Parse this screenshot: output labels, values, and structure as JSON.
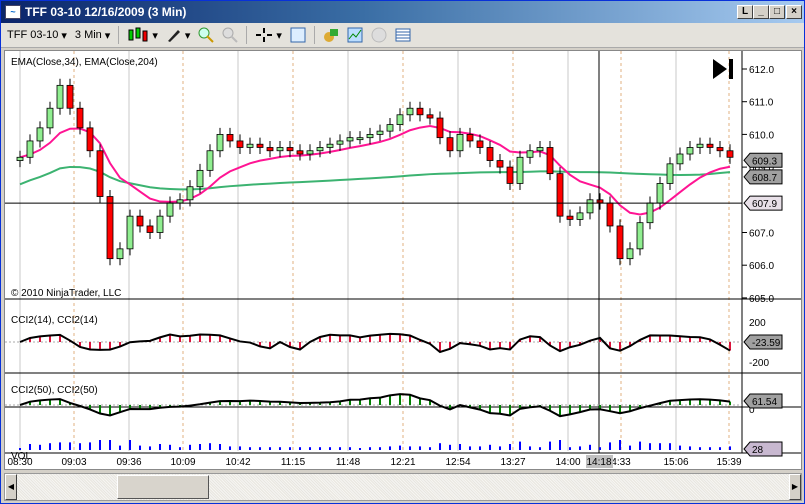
{
  "window": {
    "title": "TFF 03-10  12/16/2009 (3 Min)",
    "buttons": [
      "L",
      "_",
      "□",
      "×"
    ]
  },
  "toolbar": {
    "instrument": "TFF 03-10",
    "interval": "3 Min",
    "icons": [
      "candlestick-icon",
      "pencil-icon",
      "zoom-in-icon",
      "zoom-out-icon",
      "crosshair-icon",
      "properties-icon",
      "strategy-icon",
      "chart-icon",
      "disc-icon",
      "data-box-icon"
    ]
  },
  "colors": {
    "up": "#90ee90",
    "down": "#ff0000",
    "ema34": "#ff1493",
    "ema204": "#3cb371",
    "cci14": "#dc143c",
    "cci50": "#008000",
    "volume": "#0000ff"
  },
  "chart_data": [
    {
      "type": "candlestick",
      "panel": "price",
      "title": "EMA(Close,34), EMA(Close,204)",
      "copyright": "© 2010 NinjaTrader, LLC",
      "ylim": [
        605.0,
        612.4
      ],
      "yticks": [
        "612.0",
        "611.0",
        "610.0",
        "609.0",
        "607.0",
        "606.0",
        "605.0"
      ],
      "closes": [
        609.3,
        609.8,
        610.2,
        610.8,
        611.5,
        610.8,
        610.2,
        609.5,
        608.1,
        606.2,
        606.5,
        607.5,
        607.2,
        607.0,
        607.5,
        607.9,
        608.0,
        608.4,
        608.9,
        609.5,
        610.0,
        609.8,
        609.6,
        609.7,
        609.6,
        609.5,
        609.6,
        609.5,
        609.4,
        609.5,
        609.6,
        609.7,
        609.8,
        609.9,
        609.9,
        610.0,
        610.1,
        610.3,
        610.6,
        610.8,
        610.6,
        610.5,
        609.9,
        609.5,
        610.0,
        609.8,
        609.6,
        609.2,
        609.0,
        608.5,
        609.3,
        609.5,
        609.6,
        608.8,
        607.5,
        607.4,
        607.6,
        608.0,
        607.9,
        607.2,
        606.2,
        606.5,
        607.3,
        607.9,
        608.5,
        609.1,
        609.4,
        609.6,
        609.7,
        609.6,
        609.5,
        609.3
      ],
      "markers": {
        "last_price": "609.3",
        "ema": "608.7",
        "crosshair_price": "607.9"
      },
      "crosshair_price": 607.9
    },
    {
      "type": "histogram",
      "panel": "cci14",
      "title": "CCI2(14), CCI2(14)",
      "yticks": [
        "200",
        "-200"
      ],
      "last": "-23.59"
    },
    {
      "type": "histogram",
      "panel": "cci50",
      "title": "CCI2(50), CCI2(50)",
      "yticks": [
        "0"
      ],
      "last": "61.54"
    },
    {
      "type": "bar",
      "panel": "volume",
      "title": "VOL",
      "last": "28"
    }
  ],
  "xaxis": {
    "labels": [
      "08:30",
      "09:03",
      "09:36",
      "10:09",
      "10:42",
      "11:15",
      "11:48",
      "12:21",
      "12:54",
      "13:27",
      "14:00",
      "4:33",
      "15:06",
      "15:39"
    ],
    "crosshair_time": "14:18"
  }
}
